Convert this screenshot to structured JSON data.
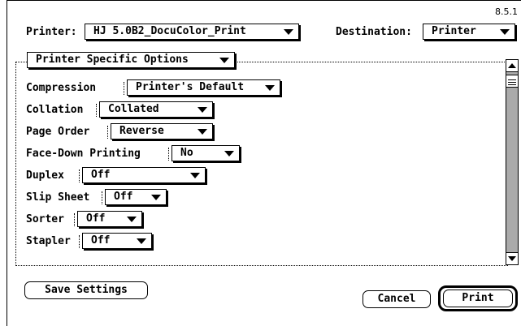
{
  "version": "8.5.1",
  "header": {
    "printer_label": "Printer:",
    "printer_value": "HJ 5.0B2_DocuColor_Print",
    "destination_label": "Destination:",
    "destination_value": "Printer"
  },
  "panel": {
    "selector_value": "Printer Specific Options"
  },
  "options": [
    {
      "label": "Compression",
      "value": "Printer's Default"
    },
    {
      "label": "Collation",
      "value": "Collated"
    },
    {
      "label": "Page Order",
      "value": "Reverse"
    },
    {
      "label": "Face-Down Printing",
      "value": "No"
    },
    {
      "label": "Duplex",
      "value": "Off"
    },
    {
      "label": "Slip Sheet",
      "value": "Off"
    },
    {
      "label": "Sorter",
      "value": "Off"
    },
    {
      "label": "Stapler",
      "value": "Off"
    }
  ],
  "buttons": {
    "save_settings": "Save Settings",
    "cancel": "Cancel",
    "print": "Print"
  }
}
